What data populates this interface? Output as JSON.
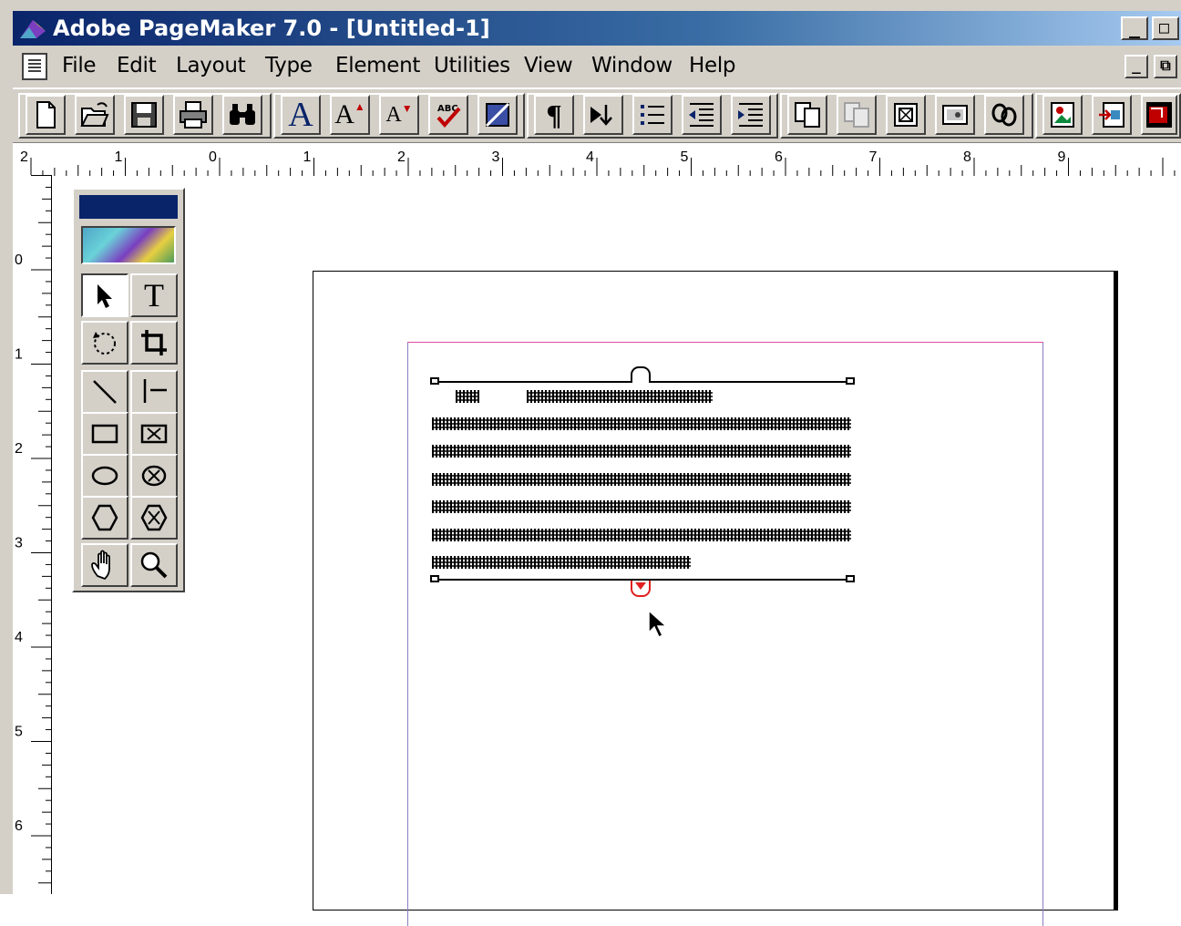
{
  "window": {
    "title": "Adobe PageMaker 7.0 - [Untitled-1]",
    "caption_buttons": [
      "_",
      "□"
    ],
    "mdi_buttons": [
      "_",
      "⧉"
    ]
  },
  "menu": {
    "items": [
      "File",
      "Edit",
      "Layout",
      "Type",
      "Element",
      "Utilities",
      "View",
      "Window",
      "Help"
    ]
  },
  "toolbar": {
    "buttons": [
      "new-icon",
      "open-icon",
      "save-icon",
      "print-icon",
      "find-icon",
      "character-format-icon",
      "increase-size-icon",
      "decrease-size-icon",
      "spelling-icon",
      "fill-stroke-icon",
      "paragraph-icon",
      "place-icon",
      "bullets-icon",
      "indent-icon",
      "outdent-icon",
      "copy-page-icon",
      "paste-page-icon",
      "frame-icon",
      "image-icon",
      "links-icon",
      "place-image-icon",
      "export-icon",
      "color-icon"
    ],
    "char_labels": {
      "character": "A",
      "increase": "A",
      "decrease": "A",
      "spelling": "ABC",
      "paragraph": "¶"
    }
  },
  "rulers": {
    "horizontal_labels": [
      "2",
      "1",
      "0",
      "1",
      "2",
      "3",
      "4",
      "5",
      "6",
      "7",
      "8",
      "9"
    ],
    "vertical_labels": [
      "0",
      "1",
      "2",
      "3",
      "4",
      "5",
      "6"
    ]
  },
  "toolbox": {
    "tools": [
      "pointer-tool",
      "text-tool",
      "rotate-tool",
      "crop-tool",
      "line-tool",
      "constrained-line-tool",
      "rectangle-tool",
      "rectangle-frame-tool",
      "ellipse-tool",
      "ellipse-frame-tool",
      "polygon-tool",
      "polygon-frame-tool",
      "hand-tool",
      "zoom-tool"
    ],
    "text_tool_label": "T",
    "active_tool": "pointer-tool"
  },
  "colors": {
    "titlebar_start": "#0a246a",
    "titlebar_end": "#a6caf0",
    "chrome": "#d4d0c8",
    "margin_top": "#e04aa0",
    "margin_side": "#8e7cc3",
    "windowshade_bottom": "#e02020"
  }
}
